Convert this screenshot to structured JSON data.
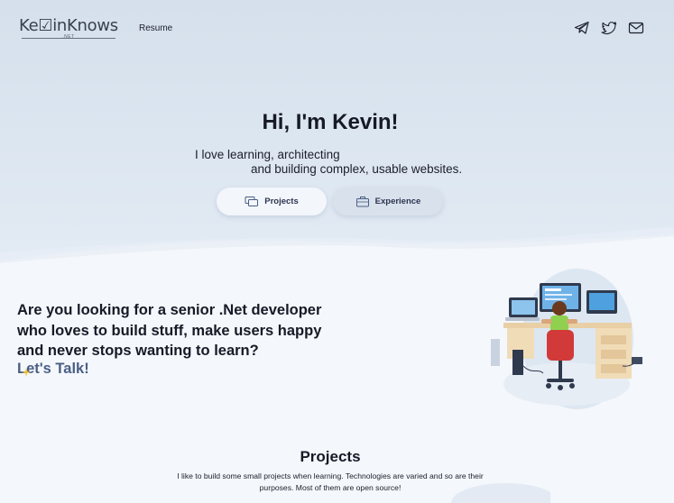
{
  "header": {
    "logo_text_a": "Ke",
    "logo_text_b": "inKnows",
    "logo_sub": ".NET",
    "nav_resume": "Resume",
    "social_icons": [
      "telegram-icon",
      "twitter-icon",
      "mail-icon"
    ]
  },
  "hero": {
    "title": "Hi, I'm Kevin!",
    "line1": "I love learning, architecting",
    "line2": "and building complex, usable websites.",
    "projects_button": "Projects",
    "experience_button": "Experience"
  },
  "pitch": {
    "line1": "Are you looking for a senior .Net developer",
    "line2": "who loves to build stuff, make users happy",
    "line3": "and never stops wanting to learn?",
    "cta": "Let's Talk!"
  },
  "projects": {
    "title": "Projects",
    "description_line1": "I like to build some small projects when learning. Technologies are varied and so are their",
    "description_line2": "purposes. Most of them are open source!"
  },
  "colors": {
    "hero_bg": "#d5e0ec",
    "page_bg": "#f4f7fb",
    "cta_text": "#4a5f85",
    "heading": "#161a26"
  }
}
